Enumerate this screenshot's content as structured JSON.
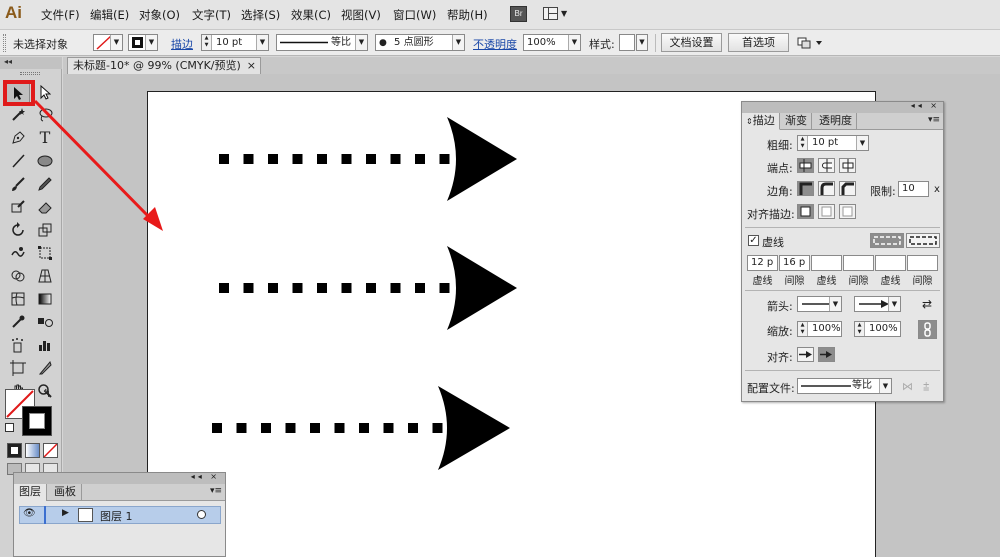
{
  "app": {
    "logo": "Ai"
  },
  "menu": [
    "文件(F)",
    "编辑(E)",
    "对象(O)",
    "文字(T)",
    "选择(S)",
    "效果(C)",
    "视图(V)",
    "窗口(W)",
    "帮助(H)"
  ],
  "menu_extras": {
    "bridge_label": "Br"
  },
  "control_bar": {
    "selection_status": "未选择对象",
    "stroke_link": "描边",
    "stroke_weight": "10 pt",
    "stroke_profile": "等比",
    "brush_label": "5 点圆形",
    "opacity_link": "不透明度",
    "opacity_value": "100%",
    "style_label": "样式:",
    "doc_setup_button": "文档设置",
    "preferences_button": "首选项"
  },
  "document": {
    "tab_title": "未标题-10* @ 99% (CMYK/预览)",
    "close_glyph": "×"
  },
  "stroke_panel": {
    "tabs": [
      "描边",
      "渐变",
      "透明度"
    ],
    "weight_label": "粗细:",
    "weight_value": "10 pt",
    "cap_label": "端点:",
    "corner_label": "边角:",
    "limit_label": "限制:",
    "limit_value": "10",
    "limit_unit": "x",
    "align_label": "对齐描边:",
    "dashed_label": "虚线",
    "dashed_checked": true,
    "dash_values": [
      "12 p",
      "16 p",
      "",
      "",
      "",
      ""
    ],
    "dash_labels": [
      "虚线",
      "间隙",
      "虚线",
      "间隙",
      "虚线",
      "间隙"
    ],
    "arrowheads_label": "箭头:",
    "scale_label": "缩放:",
    "scale_start": "100%",
    "scale_end": "100%",
    "arrow_align_label": "对齐:",
    "profile_label": "配置文件:",
    "profile_value": "等比"
  },
  "layers_panel": {
    "tabs": [
      "图层",
      "画板"
    ],
    "layer_name": "图层 1"
  },
  "colors": {
    "highlight": "#e01a1a",
    "annotation_arrow": "#e81a1a",
    "layer_selected": "#b7cdea",
    "link_blue": "#1a48a8"
  },
  "canvas": {
    "arrow_count": 3,
    "dashes_per_arrow": [
      10,
      10,
      10
    ]
  }
}
